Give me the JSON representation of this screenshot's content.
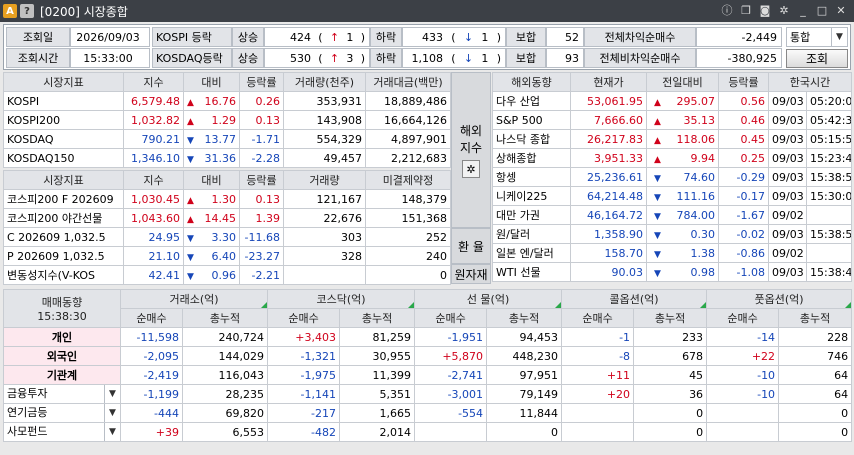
{
  "title": "[0200] 시장종합",
  "app": {
    "badge_a": "A",
    "badge_q": "?"
  },
  "colors": {
    "up": "#d0021b",
    "down": "#1646b8",
    "header": "#e2e4e8"
  },
  "top": {
    "date_label": "조회일",
    "date_value": "2026/09/03",
    "time_label": "조회시간",
    "time_value": "15:33:00",
    "kospi_label": "KOSPI 등락",
    "kosdaq_label": "KOSDAQ등락",
    "up_label": "상승",
    "down_label": "하락",
    "flat_label": "보합",
    "kospi_up": "424",
    "kospi_up_limit": "1",
    "kospi_down": "433",
    "kospi_down_limit": "1",
    "kospi_flat": "52",
    "kosdaq_up": "530",
    "kosdaq_up_limit": "3",
    "kosdaq_down": "1,108",
    "kosdaq_down_limit": "1",
    "kosdaq_flat": "93",
    "arb_label": "전체차익순매수",
    "arb_value": "-2,449",
    "nonarb_label": "전체비차익순매수",
    "nonarb_value": "-380,925",
    "select_value": "통합",
    "query_button": "조회",
    "up_arrow": "↑",
    "down_arrow": "↓",
    "paren_open": "(",
    "paren_close": ")"
  },
  "index1": {
    "headers": [
      "시장지표",
      "지수",
      "대비",
      "등락률",
      "거래량(천주)",
      "거래대금(백만)"
    ],
    "rows": [
      {
        "name": "KOSPI",
        "value": "6,579.48",
        "dir": "up",
        "change": "16.76",
        "rate": "0.26",
        "vol": "353,931",
        "amt": "18,889,486"
      },
      {
        "name": "KOSPI200",
        "value": "1,032.82",
        "dir": "up",
        "change": "1.29",
        "rate": "0.13",
        "vol": "143,908",
        "amt": "16,664,126"
      },
      {
        "name": "KOSDAQ",
        "value": "790.21",
        "dir": "down",
        "change": "13.77",
        "rate": "-1.71",
        "vol": "554,329",
        "amt": "4,897,901"
      },
      {
        "name": "KOSDAQ150",
        "value": "1,346.10",
        "dir": "down",
        "change": "31.36",
        "rate": "-2.28",
        "vol": "49,457",
        "amt": "2,212,683"
      }
    ]
  },
  "index2": {
    "headers": [
      "시장지표",
      "지수",
      "대비",
      "등락률",
      "거래량",
      "미결제약정"
    ],
    "rows": [
      {
        "name": "코스피200 F 202609",
        "value": "1,030.45",
        "dir": "up",
        "change": "1.30",
        "rate": "0.13",
        "vol": "121,167",
        "amt": "148,379"
      },
      {
        "name": "코스피200 야간선물",
        "value": "1,043.60",
        "dir": "up",
        "change": "14.45",
        "rate": "1.39",
        "vol": "22,676",
        "amt": "151,368"
      },
      {
        "name": "C 202609 1,032.5",
        "value": "24.95",
        "dir": "down",
        "change": "3.30",
        "rate": "-11.68",
        "vol": "303",
        "amt": "252"
      },
      {
        "name": "P 202609 1,032.5",
        "value": "21.10",
        "dir": "down",
        "change": "6.40",
        "rate": "-23.27",
        "vol": "328",
        "amt": "240"
      },
      {
        "name": "변동성지수(V-KOS",
        "value": "42.41",
        "dir": "down",
        "change": "0.96",
        "rate": "-2.21",
        "vol": "",
        "amt": "0"
      }
    ]
  },
  "mid": {
    "overseas_line1": "해외",
    "overseas_line2": "지수",
    "fx_label": "환 율",
    "raw_label": "원자재"
  },
  "overseas": {
    "headers": [
      "해외동향",
      "현재가",
      "전일대비",
      "등락률",
      "한국시간"
    ],
    "rows": [
      {
        "name": "다우 산업",
        "value": "53,061.95",
        "dir": "up",
        "change": "295.07",
        "rate": "0.56",
        "date": "09/03",
        "time": "05:20:01"
      },
      {
        "name": "S&P 500",
        "value": "7,666.60",
        "dir": "up",
        "change": "35.13",
        "rate": "0.46",
        "date": "09/03",
        "time": "05:42:34"
      },
      {
        "name": "나스닥 종합",
        "value": "26,217.83",
        "dir": "up",
        "change": "118.06",
        "rate": "0.45",
        "date": "09/03",
        "time": "05:15:59"
      },
      {
        "name": "상해종합",
        "value": "3,951.33",
        "dir": "up",
        "change": "9.94",
        "rate": "0.25",
        "date": "09/03",
        "time": "15:23:48"
      },
      {
        "name": "항셍",
        "value": "25,236.61",
        "dir": "down",
        "change": "74.60",
        "rate": "-0.29",
        "date": "09/03",
        "time": "15:38:50"
      },
      {
        "name": "니케이225",
        "value": "64,214.48",
        "dir": "down",
        "change": "111.16",
        "rate": "-0.17",
        "date": "09/03",
        "time": "15:30:02"
      },
      {
        "name": "대만 가권",
        "value": "46,164.72",
        "dir": "down",
        "change": "784.00",
        "rate": "-1.67",
        "date": "09/02",
        "time": ""
      },
      {
        "name": "원/달러",
        "value": "1,358.90",
        "dir": "down",
        "change": "0.30",
        "rate": "-0.02",
        "date": "09/03",
        "time": "15:38:50"
      },
      {
        "name": "일본 엔/달러",
        "value": "158.70",
        "dir": "down",
        "change": "1.38",
        "rate": "-0.86",
        "date": "09/02",
        "time": ""
      },
      {
        "name": "WTI 선물",
        "value": "90.03",
        "dir": "down",
        "change": "0.98",
        "rate": "-1.08",
        "date": "09/03",
        "time": "15:38:49"
      }
    ]
  },
  "trade": {
    "title": "매매동향",
    "time": "15:38:30",
    "groups": [
      "거래소(억)",
      "코스닥(억)",
      "선 물(억)",
      "콜옵션(억)",
      "풋옵션(억)"
    ],
    "sub": [
      "순매수",
      "총누적"
    ],
    "rows": [
      {
        "name": "개인",
        "cells": [
          "-11,598",
          "240,724",
          "+3,403",
          "81,259",
          "-1,951",
          "94,453",
          "-1",
          "233",
          "-14",
          "228"
        ]
      },
      {
        "name": "외국인",
        "cells": [
          "-2,095",
          "144,029",
          "-1,321",
          "30,955",
          "+5,870",
          "448,230",
          "-8",
          "678",
          "+22",
          "746"
        ]
      },
      {
        "name": "기관계",
        "cells": [
          "-2,419",
          "116,043",
          "-1,975",
          "11,399",
          "-2,741",
          "97,951",
          "+11",
          "45",
          "-10",
          "64"
        ]
      },
      {
        "name": "금융투자",
        "cells": [
          "-1,199",
          "28,235",
          "-1,141",
          "5,351",
          "-3,001",
          "79,149",
          "+20",
          "36",
          "-10",
          "64"
        ]
      },
      {
        "name": "연기금등",
        "cells": [
          "-444",
          "69,820",
          "-217",
          "1,665",
          "-554",
          "11,844",
          "",
          "0",
          "",
          "0"
        ]
      },
      {
        "name": "사모펀드",
        "cells": [
          "+39",
          "6,553",
          "-482",
          "2,014",
          "",
          "0",
          "",
          "0",
          "",
          "0"
        ]
      }
    ]
  }
}
